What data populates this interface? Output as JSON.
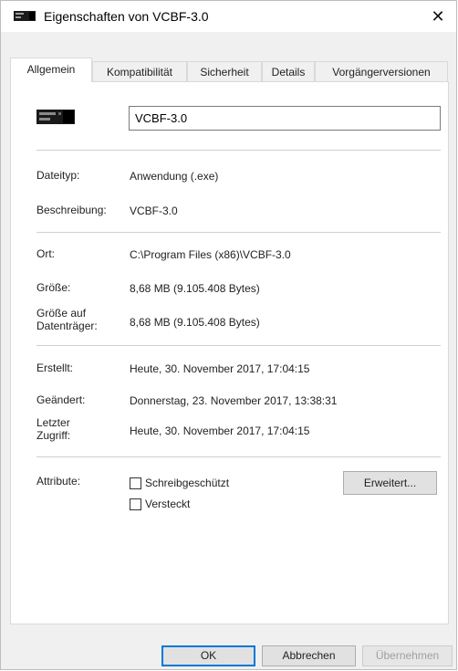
{
  "window": {
    "title": "Eigenschaften von VCBF-3.0",
    "close_glyph": "✕"
  },
  "tabs": [
    {
      "label": "Allgemein",
      "active": true
    },
    {
      "label": "Kompatibilität"
    },
    {
      "label": "Sicherheit"
    },
    {
      "label": "Details"
    },
    {
      "label": "Vorgängerversionen"
    }
  ],
  "general": {
    "icon": "application-window-icon",
    "file_name": "VCBF-3.0",
    "rows": {
      "dateityp": {
        "label": "Dateityp:",
        "value": "Anwendung (.exe)"
      },
      "beschreibung": {
        "label": "Beschreibung:",
        "value": "VCBF-3.0"
      },
      "ort": {
        "label": "Ort:",
        "value": "C:\\Program Files (x86)\\VCBF-3.0"
      },
      "groesse": {
        "label": "Größe:",
        "value": "8,68 MB (9.105.408 Bytes)"
      },
      "groesse_datentraeger": {
        "label_line1": "Größe auf",
        "label_line2": "Datenträger:",
        "value": "8,68 MB (9.105.408 Bytes)"
      },
      "erstellt": {
        "label": "Erstellt:",
        "value": "Heute, 30. November 2017, 17:04:15"
      },
      "geaendert": {
        "label": "Geändert:",
        "value": "Donnerstag, 23. November 2017, 13:38:31"
      },
      "letzter_zugriff": {
        "label_line1": "Letzter",
        "label_line2": "Zugriff:",
        "value": "Heute, 30. November 2017, 17:04:15"
      }
    },
    "attributes": {
      "label": "Attribute:",
      "readonly": {
        "label": "Schreibgeschützt",
        "checked": false
      },
      "hidden": {
        "label": "Versteckt",
        "checked": false
      },
      "advanced_button": "Erweitert..."
    }
  },
  "buttons": {
    "ok": "OK",
    "cancel": "Abbrechen",
    "apply": "Übernehmen"
  },
  "colors": {
    "accent": "#0078d7",
    "window_bg": "#f0f0f0",
    "panel_bg": "#ffffff"
  }
}
